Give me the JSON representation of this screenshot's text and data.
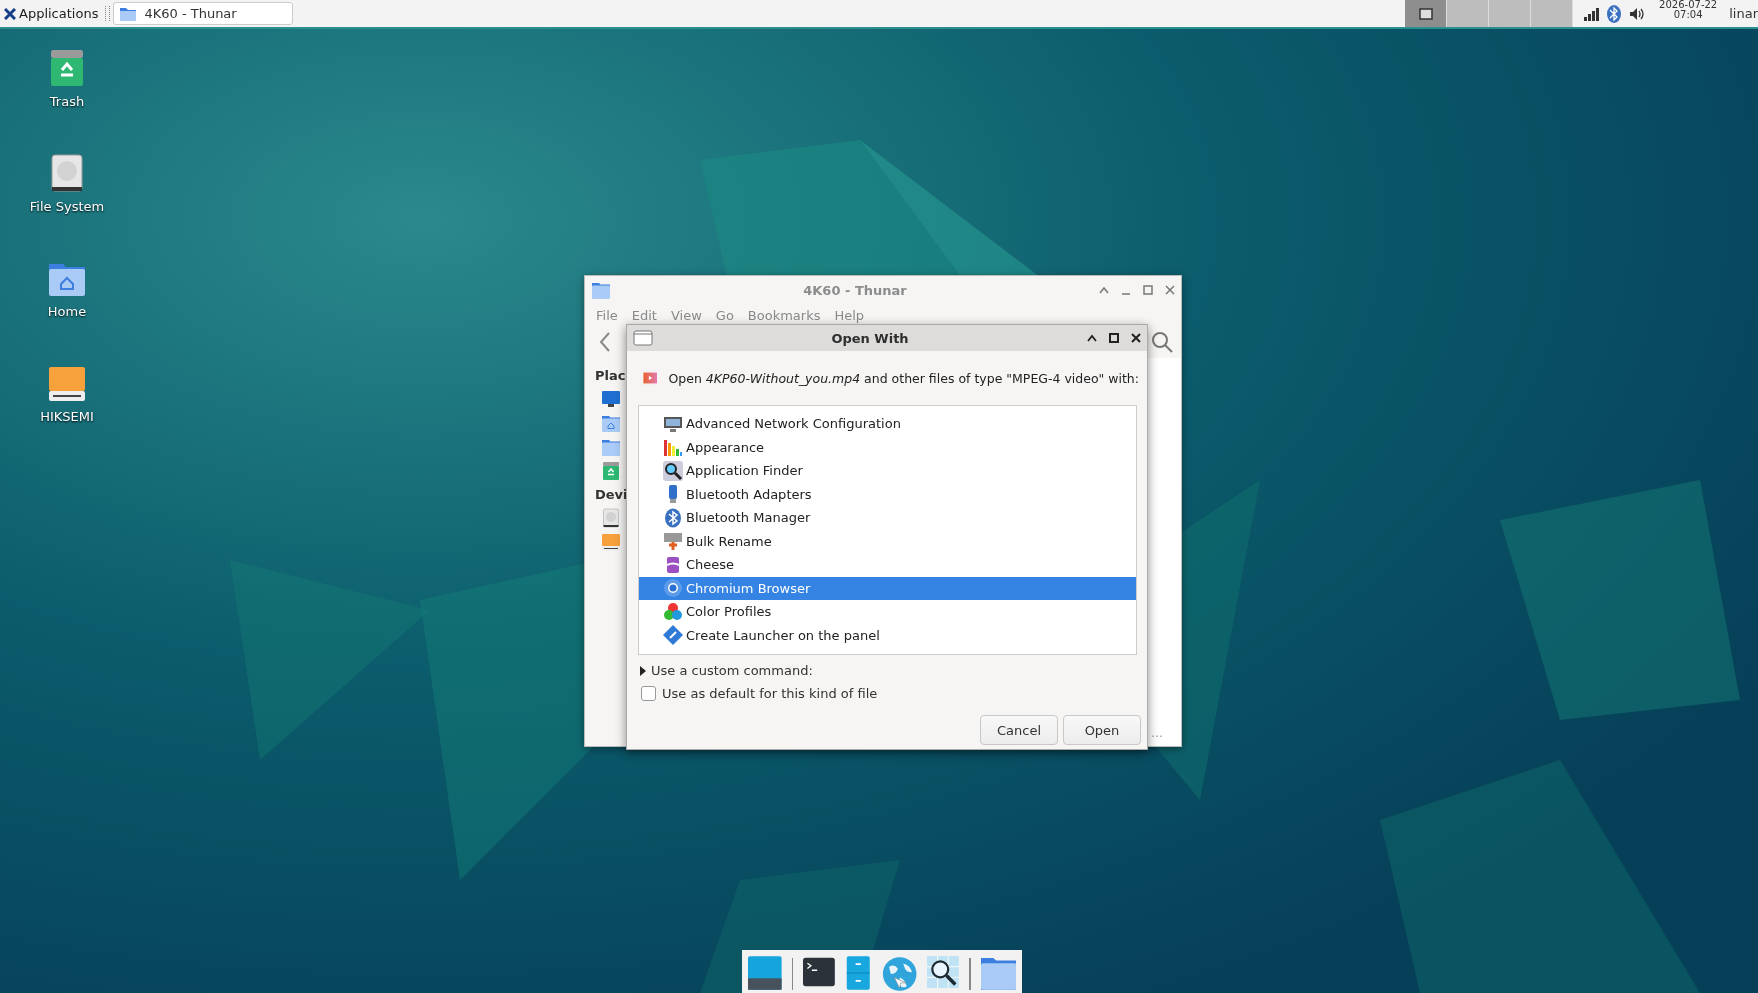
{
  "top_panel": {
    "menu_label": "Applications",
    "tasks": [
      {
        "title": "4K60 - Thunar",
        "selected": true
      }
    ],
    "workspaces": [
      {
        "selected": true
      },
      {
        "selected": false
      },
      {
        "selected": false
      },
      {
        "selected": false
      }
    ],
    "clock": {
      "date": "2026-07-22",
      "time": "07:04"
    },
    "user": "linar"
  },
  "desktop_icons": [
    {
      "label": "Trash",
      "kind": "trash"
    },
    {
      "label": "File System",
      "kind": "drive"
    },
    {
      "label": "Home",
      "kind": "home"
    },
    {
      "label": "HIKSEMI",
      "kind": "usb"
    }
  ],
  "file_manager": {
    "title": "4K60 - Thunar",
    "menu": [
      "File",
      "Edit",
      "View",
      "Go",
      "Bookmarks",
      "Help"
    ],
    "sidebar": [
      {
        "heading": "Plac",
        "items": [
          {
            "kind": "desktop"
          },
          {
            "kind": "home"
          },
          {
            "kind": "folder"
          },
          {
            "kind": "trash"
          }
        ]
      },
      {
        "heading": "Devi",
        "items": [
          {
            "kind": "drive"
          },
          {
            "kind": "usb"
          }
        ]
      }
    ],
    "status_text": "…"
  },
  "dialog": {
    "title": "Open With",
    "prompt": "Open *4KP60-Without_you.mp4* and other files of type \"MPEG-4 video\" with:",
    "apps": [
      {
        "name": "Advanced Network Configuration",
        "kind": "network",
        "selected": false
      },
      {
        "name": "Appearance",
        "kind": "appearance",
        "selected": false
      },
      {
        "name": "Application Finder",
        "kind": "finder",
        "selected": false
      },
      {
        "name": "Bluetooth Adapters",
        "kind": "bt-adapter",
        "selected": false
      },
      {
        "name": "Bluetooth Manager",
        "kind": "bluetooth",
        "selected": false
      },
      {
        "name": "Bulk Rename",
        "kind": "rename",
        "selected": false
      },
      {
        "name": "Cheese",
        "kind": "cheese",
        "selected": false
      },
      {
        "name": "Chromium Browser",
        "kind": "chromium",
        "selected": true
      },
      {
        "name": "Color Profiles",
        "kind": "color",
        "selected": false
      },
      {
        "name": "Create Launcher on the panel",
        "kind": "launcher",
        "selected": false
      }
    ],
    "custom_command": {
      "label": "Use a custom command:",
      "expanded": false
    },
    "default_checkbox": {
      "label": "Use as default for this kind of file",
      "checked": false
    },
    "buttons": [
      "Cancel",
      "Open"
    ]
  },
  "dock": [
    {
      "kind": "desktop"
    },
    {
      "kind": "terminal"
    },
    {
      "kind": "files"
    },
    {
      "kind": "web"
    },
    {
      "kind": "search"
    },
    {
      "kind": "folder"
    }
  ]
}
